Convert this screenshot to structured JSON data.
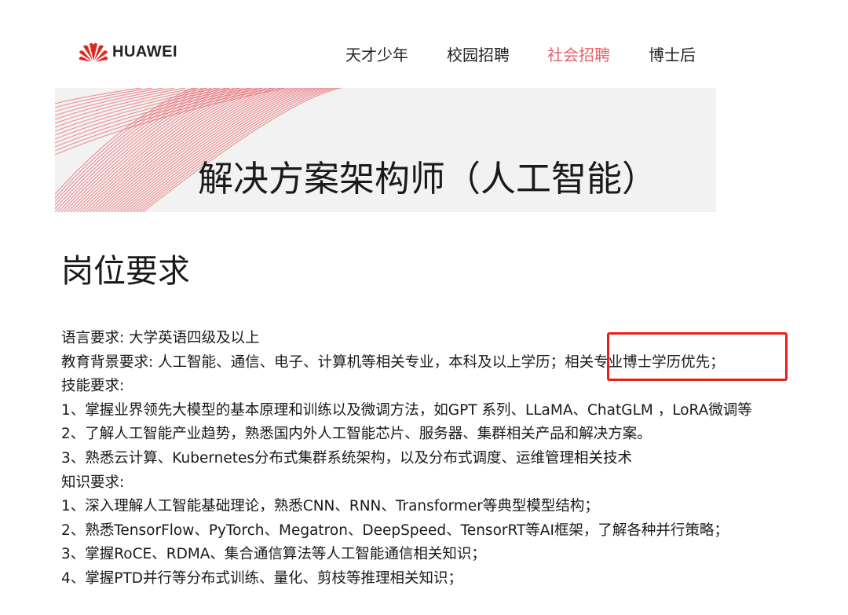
{
  "header": {
    "logo_text": "HUAWEI",
    "logo_color": "#e1261c",
    "nav": [
      {
        "label": "天才少年",
        "active": false
      },
      {
        "label": "校园招聘",
        "active": false
      },
      {
        "label": "社会招聘",
        "active": true
      },
      {
        "label": "博士后",
        "active": false
      }
    ],
    "active_color": "#e8626a"
  },
  "banner": {
    "title": "解决方案架构师（人工智能）"
  },
  "section": {
    "title": "岗位要求"
  },
  "requirements": [
    "语言要求: 大学英语四级及以上",
    "教育背景要求: 人工智能、通信、电子、计算机等相关专业，本科及以上学历；相关专业博士学历优先；",
    "技能要求:",
    "1、掌握业界领先大模型的基本原理和训练以及微调方法，如GPT 系列、LLaMA、ChatGLM ，LoRA微调等",
    "2、了解人工智能产业趋势，熟悉国内外人工智能芯片、服务器、集群相关产品和解决方案。",
    "3、熟悉云计算、Kubernetes分布式集群系统架构，以及分布式调度、运维管理相关技术",
    "知识要求:",
    "1、深入理解人工智能基础理论，熟悉CNN、RNN、Transformer等典型模型结构；",
    "2、熟悉TensorFlow、PyTorch、Megatron、DeepSpeed、TensorRT等AI框架，了解各种并行策略；",
    "3、掌握RoCE、RDMA、集合通信算法等人工智能通信相关知识；",
    "4、掌握PTD并行等分布式训练、量化、剪枝等推理相关知识；"
  ],
  "annotation": {
    "highlight_color": "#e8201a"
  }
}
